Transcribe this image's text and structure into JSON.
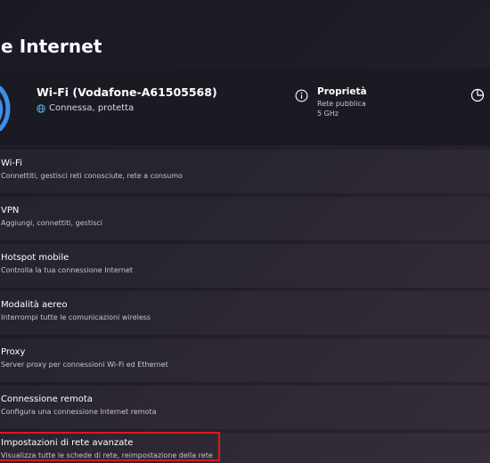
{
  "page": {
    "title": "e Internet"
  },
  "status_card": {
    "network_name": "Wi-Fi (Vodafone-A61505568)",
    "connection_status": "Connessa, protetta",
    "properties": {
      "title": "Proprietà",
      "network_type": "Rete pubblica",
      "band": "5 GHz"
    }
  },
  "settings_items": [
    {
      "title": "Wi-Fi",
      "description": "Connettiti, gestisci reti conosciute, rete a consumo"
    },
    {
      "title": "VPN",
      "description": "Aggiungi, connettiti, gestisci"
    },
    {
      "title": "Hotspot mobile",
      "description": "Controlla la tua connessione Internet"
    },
    {
      "title": "Modalità aereo",
      "description": "Interrompi tutte le comunicazioni wireless"
    },
    {
      "title": "Proxy",
      "description": "Server proxy per connessioni Wi-Fi ed Ethernet"
    },
    {
      "title": "Connessione remota",
      "description": "Configura una connessione Internet remota"
    },
    {
      "title": "Impostazioni di rete avanzate",
      "description": "Visualizza tutte le schede di rete, reimpostazione della rete"
    }
  ],
  "icons": {
    "wifi": "wifi-signal-icon",
    "globe": "globe-icon",
    "info": "info-icon",
    "data_usage": "data-usage-icon"
  },
  "colors": {
    "accent": "#3b8eea",
    "highlight": "#e0161d",
    "status_globe": "#4fb0d8"
  }
}
